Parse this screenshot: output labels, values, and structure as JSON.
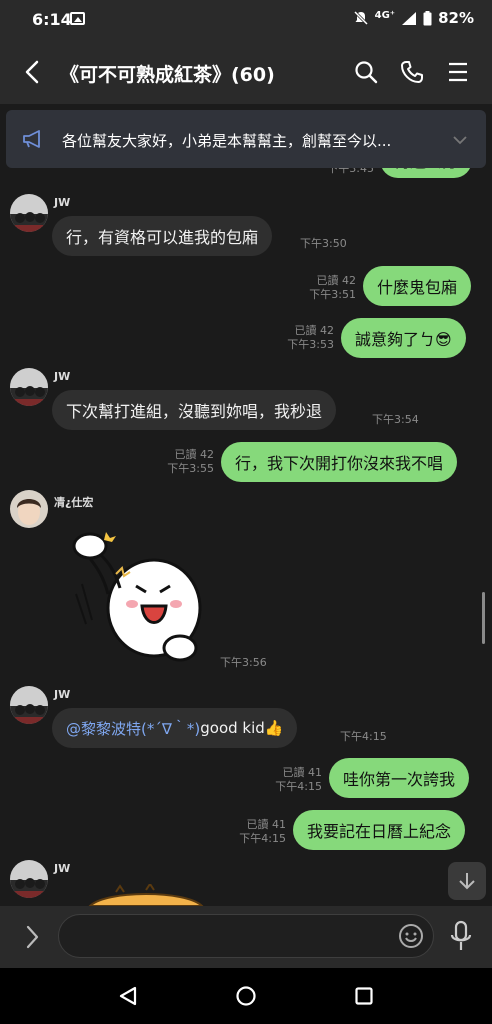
{
  "status": {
    "time": "6:14",
    "network": "4G⁺",
    "battery": "82%"
  },
  "header": {
    "title": "《可不可熟成紅茶》(60)"
  },
  "announcement": {
    "text": "各位幫友大家好，小弟是本幫幫主，創幫至今以..."
  },
  "top_partial": {
    "time": "下午3:45",
    "text": "再過去分"
  },
  "messages": {
    "m1": {
      "sender": "JW",
      "text": "行，有資格可以進我的包廂",
      "time": "下午3:50"
    },
    "m2": {
      "read": "已讀 42",
      "time": "下午3:51",
      "text": "什麼鬼包廂"
    },
    "m3": {
      "read": "已讀 42",
      "time": "下午3:53",
      "text": "誠意夠了ㄅ😎"
    },
    "m4": {
      "sender": "JW",
      "text": "下次幫打進組，沒聽到妳唱，我秒退",
      "time": "下午3:54"
    },
    "m5": {
      "read": "已讀 42",
      "time": "下午3:55",
      "text": "行，我下次開打你沒來我不唱"
    },
    "m6": {
      "sender": "凊¿仕宏",
      "time": "下午3:56"
    },
    "m7": {
      "sender": "JW",
      "mention": "@黎黎波特(*´∇｀*)",
      "text": " good kid👍",
      "time": "下午4:15"
    },
    "m8": {
      "read": "已讀 41",
      "time": "下午4:15",
      "text": "哇你第一次誇我"
    },
    "m9": {
      "read": "已讀 41",
      "time": "下午4:15",
      "text": "我要記在日曆上紀念"
    },
    "m10": {
      "sender": "JW"
    }
  },
  "input": {
    "placeholder": "",
    "value": ""
  },
  "icons": {
    "back": "chevron-left-icon",
    "search": "search-icon",
    "call": "phone-icon",
    "menu": "hamburger-menu-icon",
    "announcement": "megaphone-icon",
    "expand": "chevron-right-icon",
    "emoji": "emoji-icon",
    "mic": "microphone-icon",
    "jump": "arrow-down-icon"
  },
  "colors": {
    "outgoing_bubble": "#86d97b",
    "incoming_bubble": "#2f2f2f",
    "background": "#1b1b1b",
    "mention": "#7fa7f0"
  }
}
